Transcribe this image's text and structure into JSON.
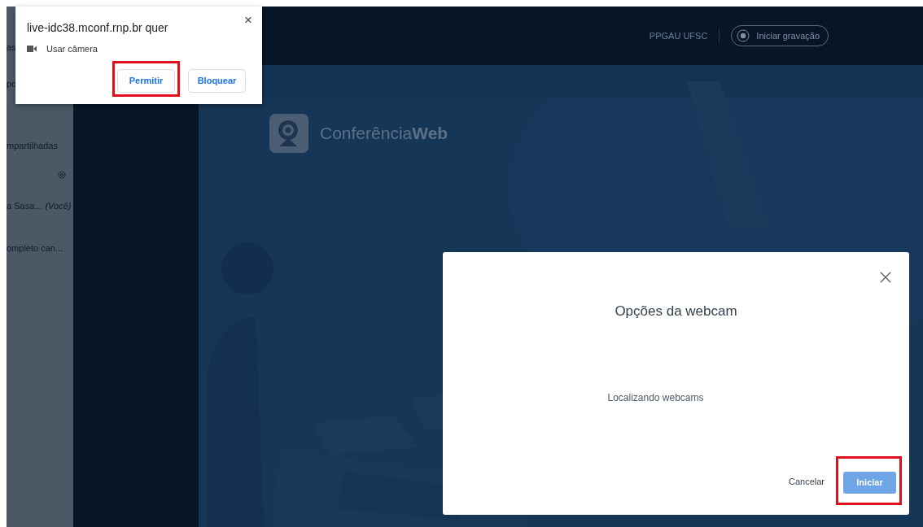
{
  "sidebar": {
    "lines": [
      {
        "kind": "text",
        "label": "as"
      },
      {
        "kind": "text",
        "label": "po"
      },
      {
        "kind": "text",
        "label": "mpartilhadas"
      },
      {
        "kind": "gear"
      },
      {
        "kind": "user",
        "label": "a Sasa...",
        "note": "(Você)"
      },
      {
        "kind": "text",
        "label": "ompleto can..."
      }
    ]
  },
  "header": {
    "room": "PPGAU UFSC",
    "record_button": "Iniciar gravação"
  },
  "logo": {
    "text": "Conferência**Web**"
  },
  "permission_popup": {
    "title": "live-idc38.mconf.rnp.br quer",
    "close": "×",
    "permission": "Usar câmera",
    "buttons": [
      {
        "label": "Permitir",
        "highlighted": true
      },
      {
        "label": "Bloquear",
        "highlighted": false
      }
    ]
  },
  "webcam_modal": {
    "title": "Opções da webcam",
    "message": "Localizando webcams",
    "buttons": [
      {
        "label": "Cancelar",
        "kind": "link",
        "highlighted": false
      },
      {
        "label": "Iniciar",
        "kind": "primary",
        "highlighted": true
      }
    ]
  }
}
